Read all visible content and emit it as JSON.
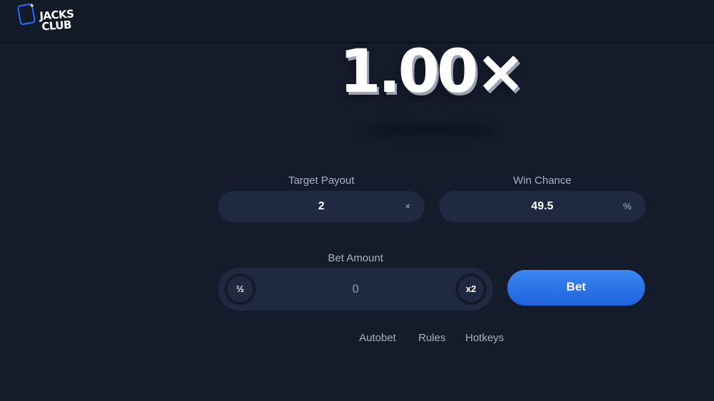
{
  "brand": {
    "logo_text_line1": "JACKS",
    "logo_text_line2": "CLUB"
  },
  "game": {
    "multiplier": "1.00×"
  },
  "target_payout": {
    "label": "Target Payout",
    "value": "2",
    "suffix": "×"
  },
  "win_chance": {
    "label": "Win Chance",
    "value": "49.5",
    "suffix": "%"
  },
  "bet_amount": {
    "label": "Bet Amount",
    "value": "0",
    "half_label": "½",
    "double_label": "x2"
  },
  "actions": {
    "bet_label": "Bet"
  },
  "links": {
    "autobet": "Autobet",
    "rules": "Rules",
    "hotkeys": "Hotkeys"
  },
  "colors": {
    "background": "#141b2b",
    "field": "#1f2940",
    "accent": "#2b75ec"
  },
  "icons": {
    "logo": "jacks-club-logo-icon"
  }
}
